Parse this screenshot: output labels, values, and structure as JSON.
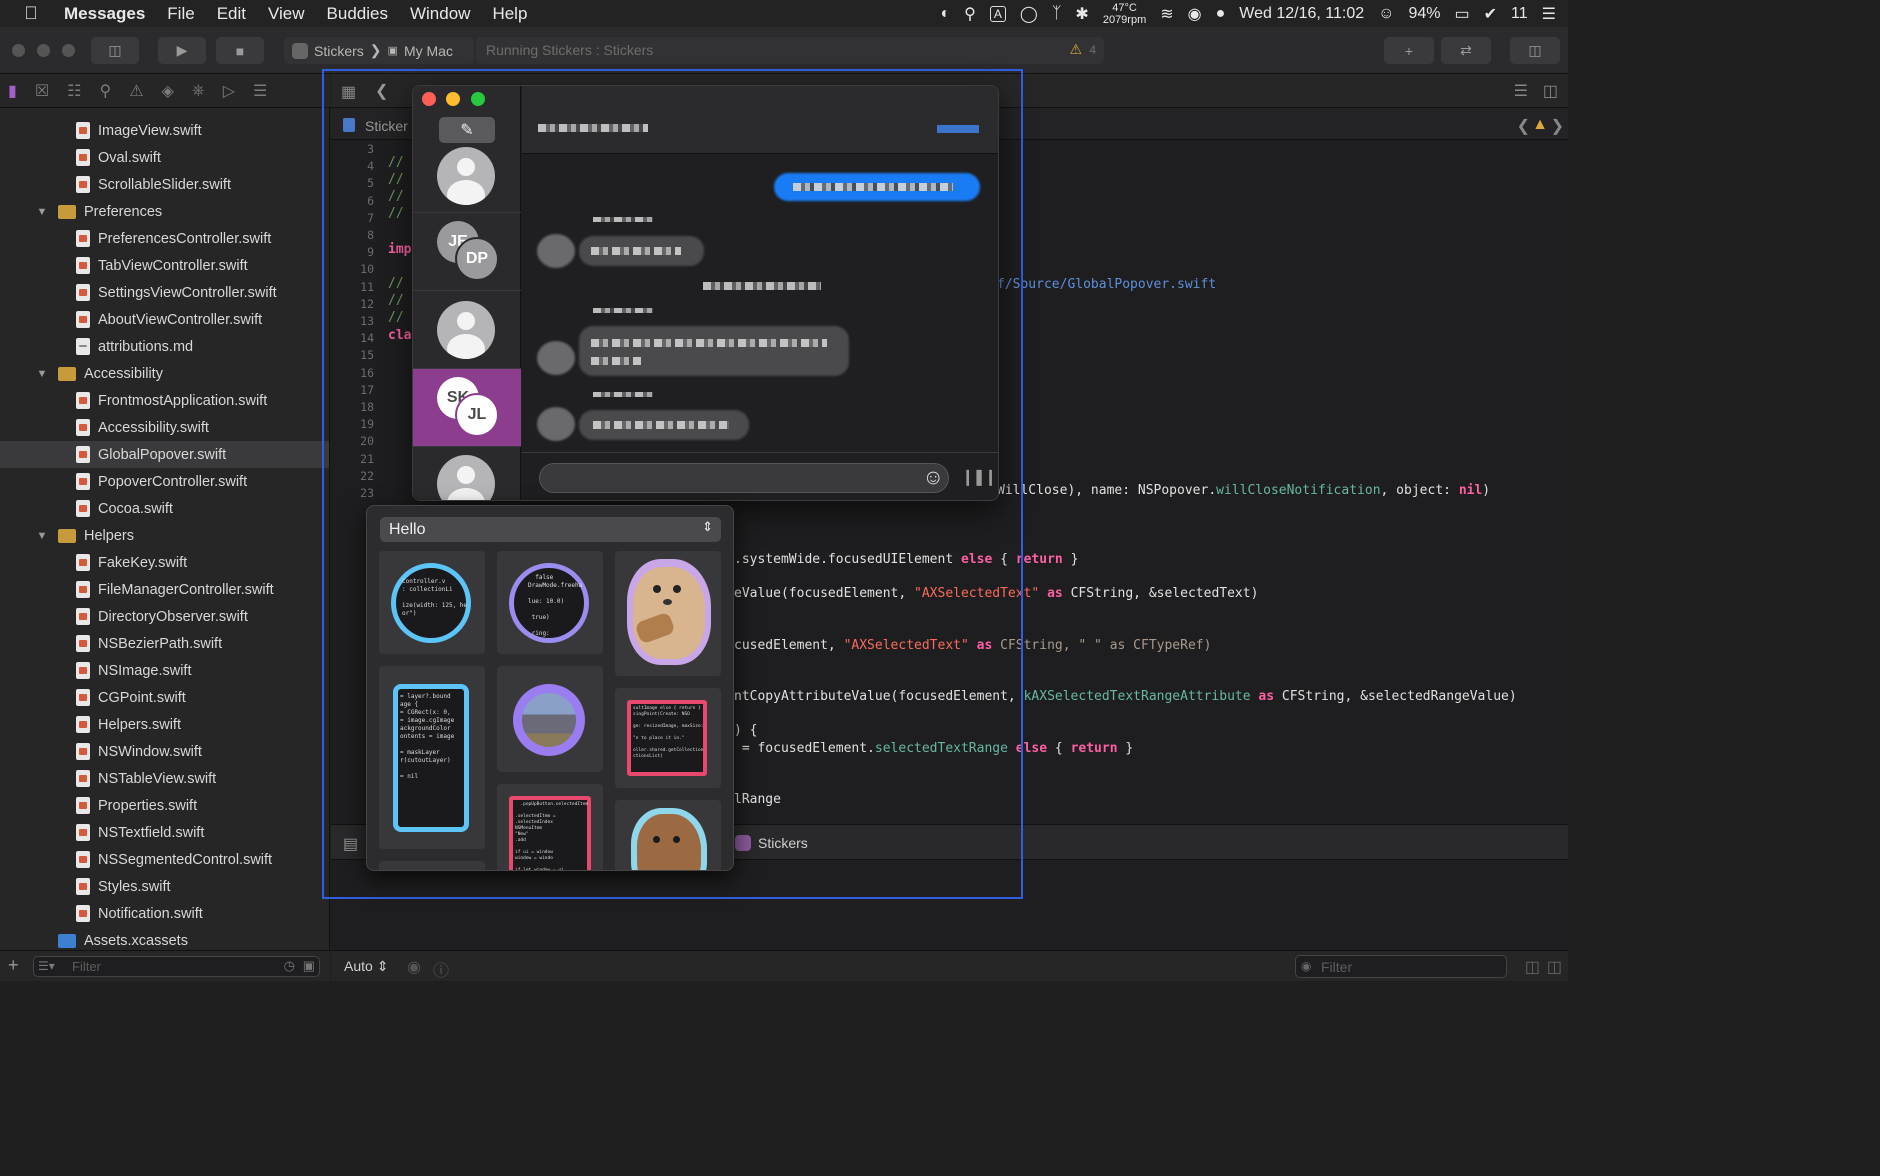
{
  "menubar": {
    "app_name": "Messages",
    "menus": [
      "File",
      "Edit",
      "View",
      "Buddies",
      "Window",
      "Help"
    ],
    "temperature": "47°C",
    "fan": "2079rpm",
    "battery": "94%",
    "datetime": "Wed 12/16, 11:02",
    "notifications_count": "11"
  },
  "toolbar": {
    "scheme": "Stickers",
    "destination": "My Mac",
    "status": "Running Stickers : Stickers",
    "warning_count": "4"
  },
  "navigator": {
    "items": [
      {
        "type": "file",
        "label": "ImageView.swift"
      },
      {
        "type": "file",
        "label": "Oval.swift"
      },
      {
        "type": "file",
        "label": "ScrollableSlider.swift"
      },
      {
        "type": "folder",
        "label": "Preferences"
      },
      {
        "type": "file",
        "label": "PreferencesController.swift"
      },
      {
        "type": "file",
        "label": "TabViewController.swift"
      },
      {
        "type": "file",
        "label": "SettingsViewController.swift"
      },
      {
        "type": "file",
        "label": "AboutViewController.swift"
      },
      {
        "type": "md",
        "label": "attributions.md"
      },
      {
        "type": "folder",
        "label": "Accessibility"
      },
      {
        "type": "file",
        "label": "FrontmostApplication.swift"
      },
      {
        "type": "file",
        "label": "Accessibility.swift"
      },
      {
        "type": "file",
        "label": "GlobalPopover.swift"
      },
      {
        "type": "file",
        "label": "PopoverController.swift"
      },
      {
        "type": "file",
        "label": "Cocoa.swift"
      },
      {
        "type": "folder",
        "label": "Helpers"
      },
      {
        "type": "file",
        "label": "FakeKey.swift"
      },
      {
        "type": "file",
        "label": "FileManagerController.swift"
      },
      {
        "type": "file",
        "label": "DirectoryObserver.swift"
      },
      {
        "type": "file",
        "label": "NSBezierPath.swift"
      },
      {
        "type": "file",
        "label": "NSImage.swift"
      },
      {
        "type": "file",
        "label": "CGPoint.swift"
      },
      {
        "type": "file",
        "label": "Helpers.swift"
      },
      {
        "type": "file",
        "label": "NSWindow.swift"
      },
      {
        "type": "file",
        "label": "NSTableView.swift"
      },
      {
        "type": "file",
        "label": "Properties.swift"
      },
      {
        "type": "file",
        "label": "NSTextfield.swift"
      },
      {
        "type": "file",
        "label": "NSSegmentedControl.swift"
      },
      {
        "type": "file",
        "label": "Styles.swift"
      },
      {
        "type": "file",
        "label": "Notification.swift"
      },
      {
        "type": "assets",
        "label": "Assets.xcassets"
      }
    ],
    "filter_placeholder": "Filter"
  },
  "editor": {
    "tab_label": "Sticker",
    "line_numbers": [
      "3",
      "4",
      "5",
      "6",
      "7",
      "8",
      "9",
      "10",
      "11",
      "12",
      "13",
      "14",
      "15",
      "16",
      "17",
      "18",
      "19",
      "20",
      "21",
      "22",
      "23"
    ],
    "path_fragment": "f/Source/GlobalPopover.swift",
    "code_lines": {
      "l1_a": "WillClose), name: NSPopover.",
      "l1_b": "willCloseNotification",
      "l1_c": ", object: ",
      "l1_d": "nil",
      "l1_e": ")",
      "l2_a": ".systemWide.focusedUIElement ",
      "l2_b": "else",
      "l2_c": " { ",
      "l2_d": "return",
      "l2_e": " }",
      "l3_a": "eValue(focusedElement, ",
      "l3_b": "\"AXSelectedText\"",
      "l3_c": " as ",
      "l3_d": "CFString, &selectedText)",
      "l4_a": "cusedElement, ",
      "l4_b": "\"AXSelectedText\"",
      "l4_c": " as ",
      "l4_d": "CFString, \" \" as CFTypeRef)",
      "l5_a": "ntCopyAttributeValue(focusedElement, ",
      "l5_b": "kAXSelectedTextRangeAttribute",
      "l5_c": " as ",
      "l5_d": "CFString, &selectedRangeValue)",
      "l6_a": ") {",
      "l7_a": " = focusedElement.",
      "l7_b": "selectedTextRange",
      "l7_c": " else",
      "l7_d": " { ",
      "l7_e": "return",
      "l7_f": " }",
      "l8_a": "lRange"
    },
    "left_code": {
      "c3": "//",
      "c4": "//",
      "c5": "//",
      "c6": "//",
      "c7": "//",
      "c9": "imp",
      "c11": "//",
      "c12": "//",
      "c13": "//",
      "c14": "cla"
    }
  },
  "debugbar": {
    "target_label": "Stickers"
  },
  "bottombar": {
    "auto_label": "Auto",
    "filter_placeholder": "Filter"
  },
  "messages": {
    "conversations": [
      {
        "initials": ""
      },
      {
        "initials": "JE",
        "second_initials": "DP"
      },
      {
        "initials": ""
      },
      {
        "initials": "SK",
        "second_initials": "JL",
        "selected": true
      },
      {
        "initials": ""
      }
    ]
  },
  "sticker_popover": {
    "pack_name": "Hello",
    "stickers": [
      {
        "name": "code-ring-blue",
        "code": "Controller.v\n: collectionLi\n\nize(width: 125, he\nor\")"
      },
      {
        "name": "code-ring-purple",
        "code": "  false\nDrawMode.freeha\n\nlue: 10.0)\n\n true)\n\n ring:"
      },
      {
        "name": "puppy-sticker"
      },
      {
        "name": "code-phone-blue",
        "code": "= layer?.bound\nage {\n= CGRect(x: 0,\n= image.cgImage\nackgroundColor\nontents = image\n\n= maskLayer\nr(cutoutLayer)\n\n= nil"
      },
      {
        "name": "city-ring-purple"
      },
      {
        "name": "code-frame-pink",
        "code": "sultImage else { return }\nsingPoint(Create: NSO\n\nge: resizedImage, maxSize:\n\n\"n to place it in.\"\n\noller.shared.getCollection\nctionsList)"
      },
      {
        "name": "code-frame-pink-2",
        "code": "  .popUpButton.selectedItem\n\n.selectedItem =\n.selectedIndex\nNSMenuItem\n\"New\"\n.add\n\nif ui = window\nwindow = windo\n\nif let window = ui\nsingleWindowDelegat\n"
      },
      {
        "name": "puppy-sticker-2"
      }
    ]
  },
  "colors": {
    "selection_outline": "#2f5fe0",
    "conversation_selected": "#8c3d8e",
    "imessage_bubble": "#1a7cf5",
    "ring_blue": "#5cc4f7",
    "ring_purple": "#9a8df0",
    "frame_pink": "#e8486e"
  }
}
